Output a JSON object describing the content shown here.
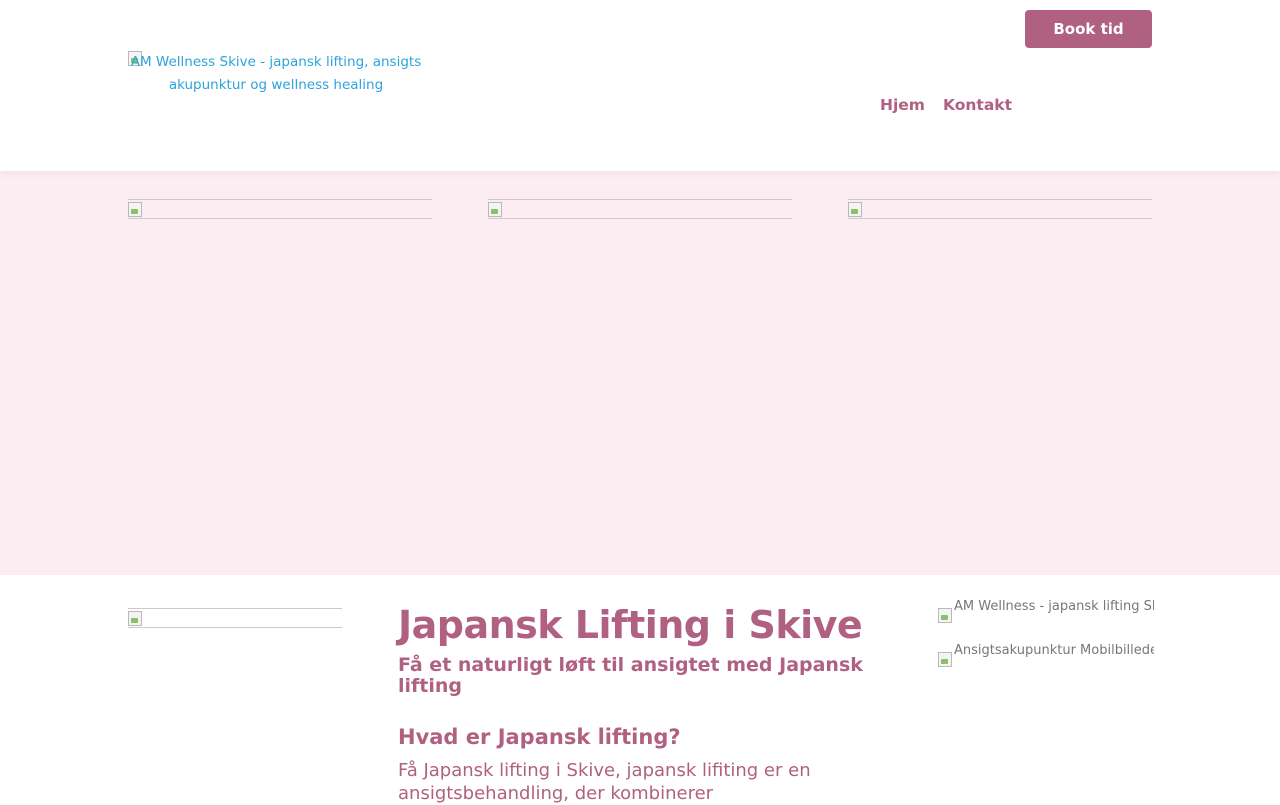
{
  "header": {
    "book_button": "Book tid",
    "logo_alt": "AM Wellness Skive - japansk lifting, ansigts akupunktur og wellness healing",
    "nav": [
      "Hjem",
      "Kontakt"
    ]
  },
  "main": {
    "title": "Japansk Lifting i Skive",
    "subtitle": "Få et naturligt løft til ansigtet med Japansk lifting",
    "section_heading": "Hvad er Japansk lifting?",
    "paragraph": "Få Japansk lifting i Skive, japansk lifiting er en ansigtsbehandling, der kombinerer"
  },
  "sidebar": {
    "images": [
      {
        "alt": "AM Wellness - japansk lifting Skive"
      },
      {
        "alt": "Ansigtsakupunktur Mobilbillede"
      }
    ]
  },
  "colors": {
    "accent": "#b06080",
    "hero_background": "#fcedf3",
    "logo_link": "#2ea3dc"
  }
}
